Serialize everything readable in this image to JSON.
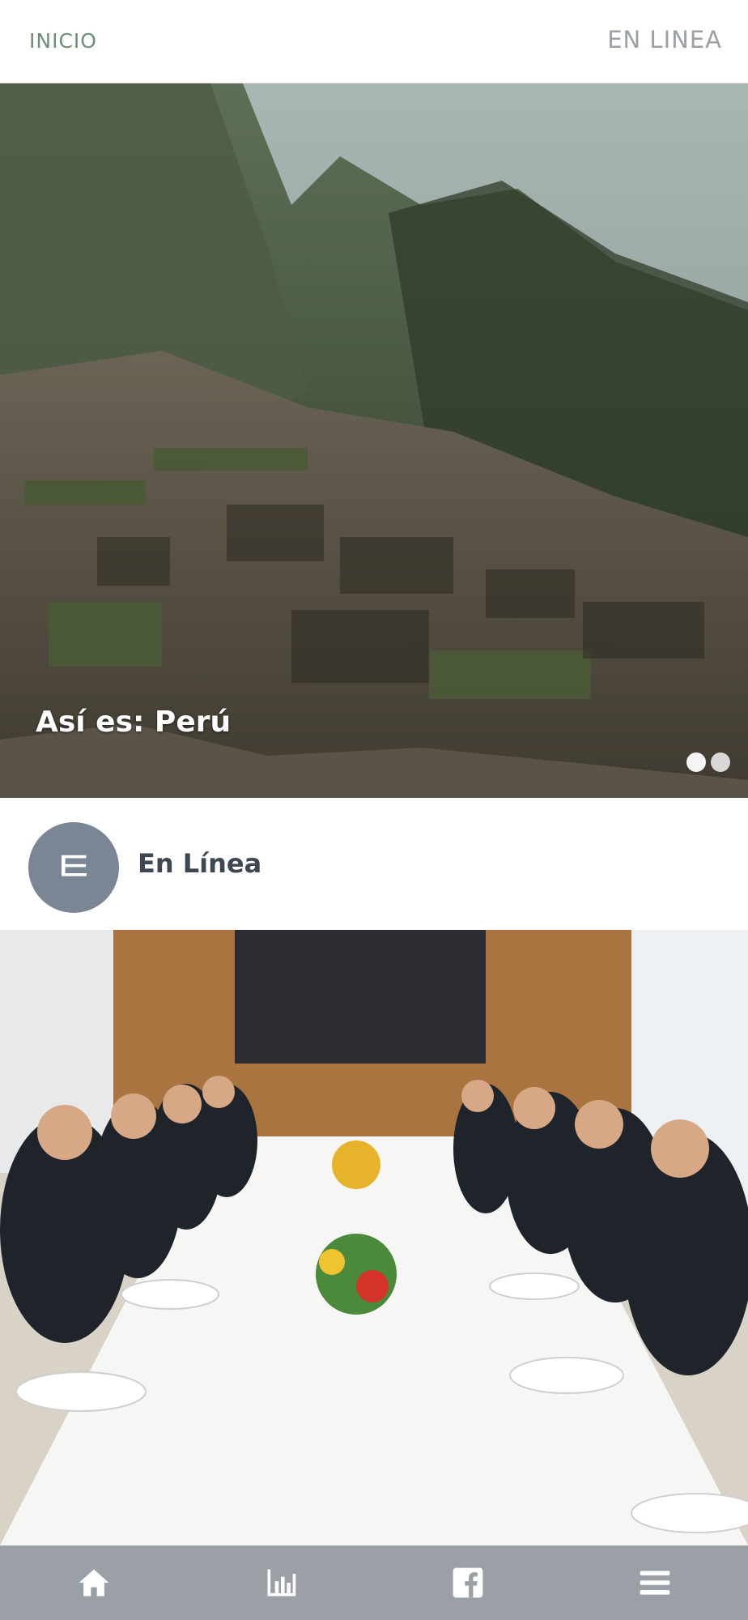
{
  "header": {
    "left_label": "INICIO",
    "right_label": "EN LINEA"
  },
  "hero": {
    "caption": "Así es: Perú",
    "slide_count": 2,
    "active_slide": 1
  },
  "section": {
    "avatar_glyph": "ㅌ",
    "title": "En Línea"
  },
  "bottom_nav": {
    "items": [
      {
        "icon": "home-icon"
      },
      {
        "icon": "bar-chart-icon"
      },
      {
        "icon": "facebook-icon"
      },
      {
        "icon": "menu-icon"
      }
    ]
  },
  "colors": {
    "nav_green": "#6d8f77",
    "nav_grey": "#9aa0a6",
    "avatar_bg": "#7b8694",
    "bottom_bar": "#9aa0a6"
  }
}
